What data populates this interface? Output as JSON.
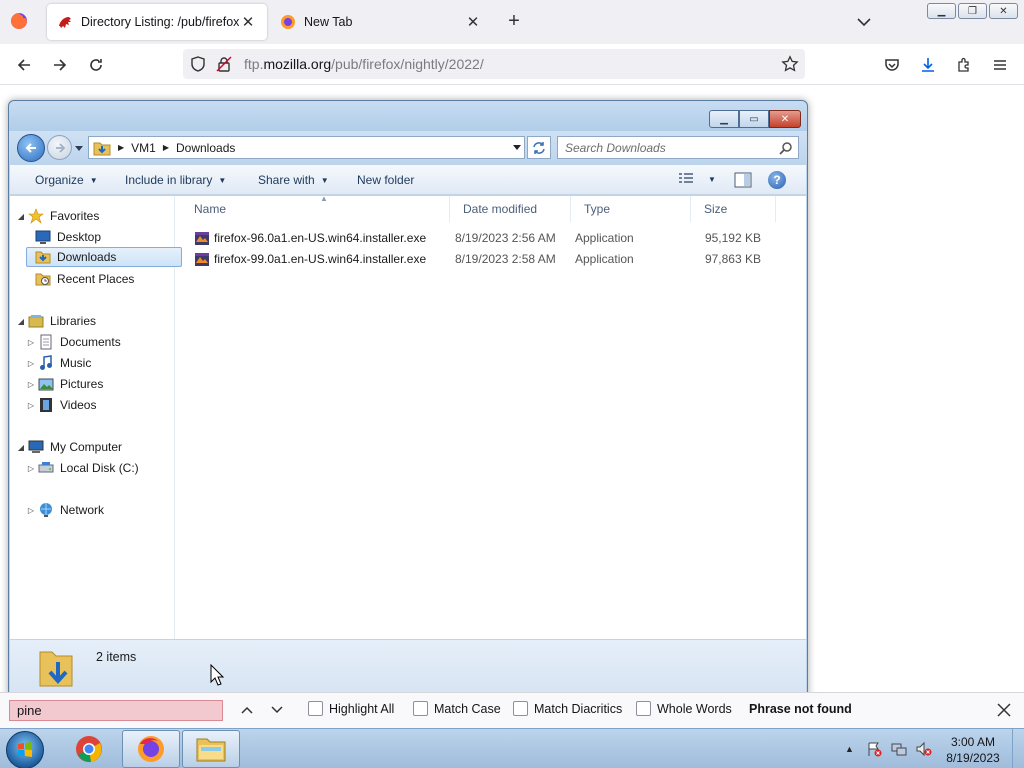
{
  "firefox": {
    "tabs": [
      {
        "title": "Directory Listing: /pub/firefox/nightly/2022/",
        "active": true
      },
      {
        "title": "New Tab",
        "active": false
      }
    ],
    "url_prefix": "ftp.",
    "url_domain": "mozilla.org",
    "url_path": "/pub/firefox/nightly/2022/"
  },
  "explorer": {
    "breadcrumb": [
      "VM1",
      "Downloads"
    ],
    "search_placeholder": "Search Downloads",
    "commands": {
      "organize": "Organize",
      "include_in_library": "Include in library",
      "share_with": "Share with",
      "new_folder": "New folder"
    },
    "nav": {
      "favorites": "Favorites",
      "desktop": "Desktop",
      "downloads": "Downloads",
      "recent_places": "Recent Places",
      "libraries": "Libraries",
      "documents": "Documents",
      "music": "Music",
      "pictures": "Pictures",
      "videos": "Videos",
      "my_computer": "My Computer",
      "local_disk": "Local Disk (C:)",
      "network": "Network"
    },
    "columns": {
      "name": "Name",
      "date": "Date modified",
      "type": "Type",
      "size": "Size"
    },
    "files": [
      {
        "name": "firefox-96.0a1.en-US.win64.installer.exe",
        "date": "8/19/2023 2:56 AM",
        "type": "Application",
        "size": "95,192 KB"
      },
      {
        "name": "firefox-99.0a1.en-US.win64.installer.exe",
        "date": "8/19/2023 2:58 AM",
        "type": "Application",
        "size": "97,863 KB"
      }
    ],
    "status": "2 items"
  },
  "findbar": {
    "query": "pine",
    "highlight_all": "Highlight All",
    "match_case": "Match Case",
    "match_diacritics": "Match Diacritics",
    "whole_words": "Whole Words",
    "status": "Phrase not found"
  },
  "taskbar": {
    "time": "3:00 AM",
    "date": "8/19/2023"
  }
}
